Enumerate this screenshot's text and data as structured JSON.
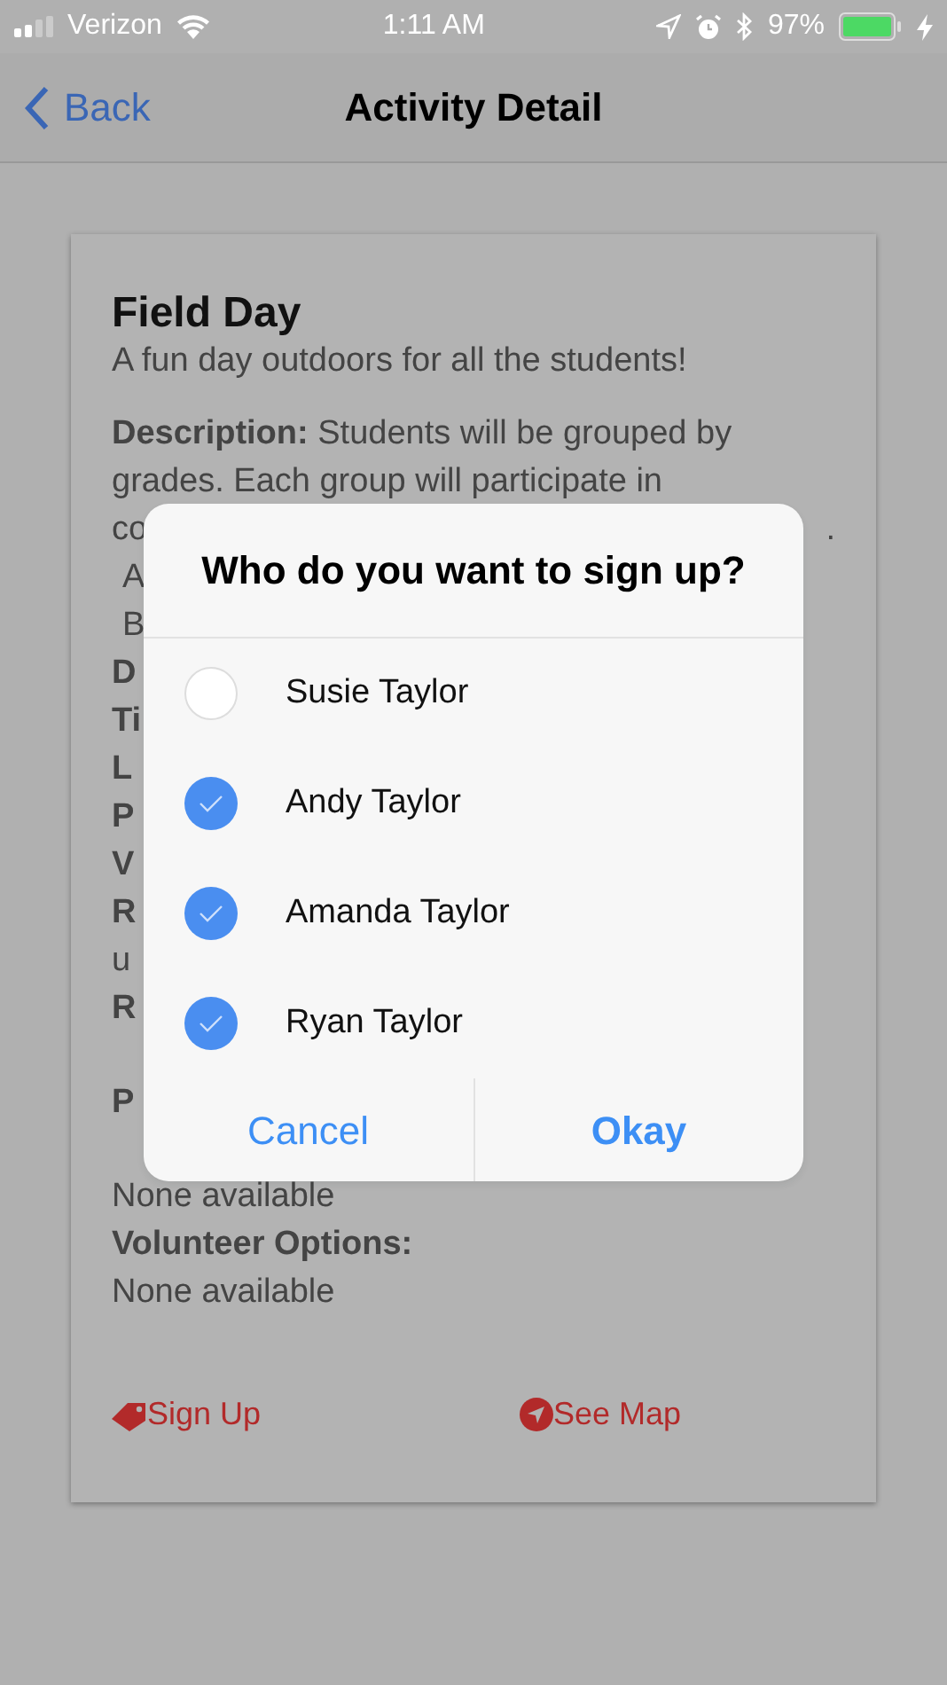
{
  "status_bar": {
    "carrier": "Verizon",
    "time": "1:11 AM",
    "battery": "97%"
  },
  "nav": {
    "back": "Back",
    "title": "Activity Detail"
  },
  "activity": {
    "title": "Field Day",
    "subtitle": "A fun day outdoors for all the students!",
    "lines": [
      {
        "kind": "labeled",
        "label": "Description:",
        "text": "Students will be grouped by"
      },
      {
        "kind": "plain",
        "text": "grades.  Each group will participate in"
      },
      {
        "kind": "split",
        "text": "co",
        "end": "."
      },
      {
        "kind": "indent",
        "text": "A"
      },
      {
        "kind": "indent",
        "text": "B"
      },
      {
        "kind": "bold",
        "text": "D"
      },
      {
        "kind": "bold",
        "text": "Ti"
      },
      {
        "kind": "bold",
        "text": "L"
      },
      {
        "kind": "bold",
        "text": "P"
      },
      {
        "kind": "bold",
        "text": "V"
      },
      {
        "kind": "bold",
        "text": "R"
      },
      {
        "kind": "plain",
        "text": "u"
      },
      {
        "kind": "bold",
        "text": "R"
      },
      {
        "kind": "bold",
        "text": "P",
        "gap_before": true
      },
      {
        "kind": "plain",
        "text": "None available",
        "gap_before": true
      },
      {
        "kind": "bold",
        "text": "Volunteer Options:"
      },
      {
        "kind": "plain",
        "text": "None available"
      }
    ],
    "actions": [
      {
        "kind": "tag",
        "label": "Sign Up"
      },
      {
        "kind": "navigate",
        "label": "See Map"
      }
    ]
  },
  "dialog": {
    "title": "Who do you want to sign up?",
    "options": [
      {
        "name": "Susie Taylor",
        "checked": false
      },
      {
        "name": "Andy Taylor",
        "checked": true
      },
      {
        "name": "Amanda Taylor",
        "checked": true
      },
      {
        "name": "Ryan Taylor",
        "checked": true
      }
    ],
    "buttons": [
      {
        "kind": "cancel",
        "label": "Cancel"
      },
      {
        "kind": "primary",
        "label": "Okay"
      }
    ]
  }
}
